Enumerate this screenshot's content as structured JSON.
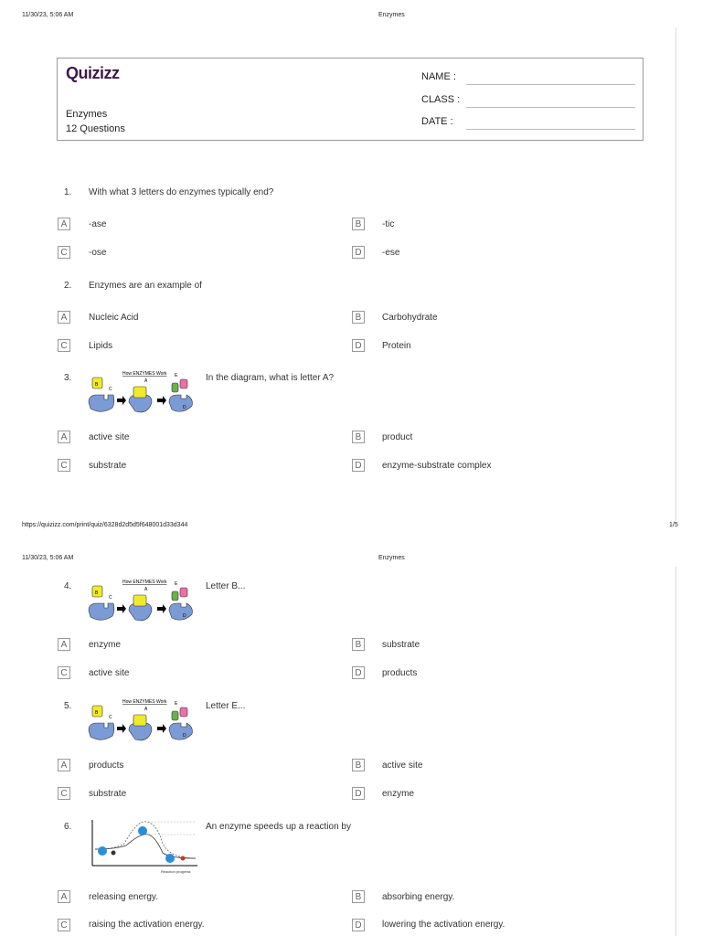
{
  "page1": {
    "header_left": "11/30/23, 5:06 AM",
    "header_center": "Enzymes",
    "footer_left": "https://quizizz.com/print/quiz/6328d2d5d5f648001d33d344",
    "footer_right": "1/5"
  },
  "page2": {
    "header_left": "11/30/23, 5:06 AM",
    "header_center": "Enzymes"
  },
  "header_box": {
    "logo": "Quizizz",
    "title": "Enzymes",
    "count": "12 Questions",
    "name_label": "NAME  :",
    "class_label": "CLASS :",
    "date_label": "DATE   :"
  },
  "diagram": {
    "title": "How ENZYMES Work",
    "labels": [
      "B",
      "C",
      "A",
      "E",
      "D"
    ]
  },
  "graph": {
    "xlabel": "Reaction progress"
  },
  "questions": [
    {
      "num": "1.",
      "text": "With what 3 letters do enzymes typically end?",
      "options": [
        {
          "letter": "A",
          "text": "-ase"
        },
        {
          "letter": "B",
          "text": "-tic"
        },
        {
          "letter": "C",
          "text": "-ose"
        },
        {
          "letter": "D",
          "text": "-ese"
        }
      ]
    },
    {
      "num": "2.",
      "text": "Enzymes are an example of",
      "options": [
        {
          "letter": "A",
          "text": "Nucleic Acid"
        },
        {
          "letter": "B",
          "text": "Carbohydrate"
        },
        {
          "letter": "C",
          "text": "Lipids"
        },
        {
          "letter": "D",
          "text": "Protein"
        }
      ]
    },
    {
      "num": "3.",
      "text": "In the diagram, what is letter A?",
      "options": [
        {
          "letter": "A",
          "text": "active site"
        },
        {
          "letter": "B",
          "text": "product"
        },
        {
          "letter": "C",
          "text": "substrate"
        },
        {
          "letter": "D",
          "text": "enzyme-substrate complex"
        }
      ]
    },
    {
      "num": "4.",
      "text": "Letter B...",
      "options": [
        {
          "letter": "A",
          "text": "enzyme"
        },
        {
          "letter": "B",
          "text": "substrate"
        },
        {
          "letter": "C",
          "text": "active site"
        },
        {
          "letter": "D",
          "text": "products"
        }
      ]
    },
    {
      "num": "5.",
      "text": "Letter E...",
      "options": [
        {
          "letter": "A",
          "text": "products"
        },
        {
          "letter": "B",
          "text": "active site"
        },
        {
          "letter": "C",
          "text": "substrate"
        },
        {
          "letter": "D",
          "text": "enzyme"
        }
      ]
    },
    {
      "num": "6.",
      "text": "An enzyme speeds up a reaction by",
      "options": [
        {
          "letter": "A",
          "text": "releasing energy."
        },
        {
          "letter": "B",
          "text": "absorbing energy."
        },
        {
          "letter": "C",
          "text": "raising the activation energy."
        },
        {
          "letter": "D",
          "text": "lowering the activation energy."
        }
      ]
    }
  ]
}
